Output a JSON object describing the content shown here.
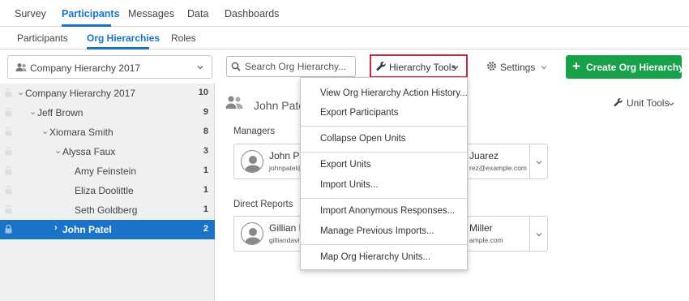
{
  "topnav": {
    "items": [
      "Survey",
      "Participants",
      "Messages",
      "Data",
      "Dashboards"
    ],
    "active": "Participants"
  },
  "subnav": {
    "items": [
      "Participants",
      "Org Hierarchies",
      "Roles"
    ],
    "active": "Org Hierarchies"
  },
  "toolbar": {
    "hierarchy_select": "Company Hierarchy 2017",
    "search_placeholder": "Search Org Hierarchy...",
    "hierarchy_tools": "Hierarchy Tools",
    "settings": "Settings",
    "create": "Create Org Hierarchy..."
  },
  "tree": [
    {
      "name": "Company Hierarchy 2017",
      "count": "10",
      "arrow": "⌄",
      "selected": false
    },
    {
      "name": "Jeff Brown",
      "count": "9",
      "arrow": "⌄",
      "selected": false
    },
    {
      "name": "Xiomara Smith",
      "count": "8",
      "arrow": "⌄",
      "selected": false
    },
    {
      "name": "Alyssa Faux",
      "count": "3",
      "arrow": "⌄",
      "selected": false
    },
    {
      "name": "Amy Feinstein",
      "count": "1",
      "arrow": "",
      "selected": false
    },
    {
      "name": "Eliza Doolittle",
      "count": "1",
      "arrow": "",
      "selected": false
    },
    {
      "name": "Seth Goldberg",
      "count": "1",
      "arrow": "",
      "selected": false
    },
    {
      "name": "John Patel",
      "count": "2",
      "arrow": "›",
      "selected": true
    }
  ],
  "main": {
    "title": "John Patel",
    "unit_tools": "Unit Tools",
    "managers_label": "Managers",
    "direct_reports_label": "Direct Reports",
    "managers_card": {
      "p1_name": "John Pa",
      "p1_email": "johnpatel@",
      "p2_name": "Juarez",
      "p2_email": "rez@example.com"
    },
    "reports_card": {
      "p1_name": "Gillian D",
      "p1_email": "gilliandavi",
      "p2_name": "Miller",
      "p2_email": "ample.com"
    }
  },
  "menu": {
    "items": [
      "View Org Hierarchy Action History...",
      "Export Participants",
      "Collapse Open Units",
      "Export Units",
      "Import Units...",
      "Import Anonymous Responses...",
      "Manage Previous Imports...",
      "Map Org Hierarchy Units..."
    ]
  },
  "colors": {
    "accent": "#1a73c7",
    "create_button": "#18a04a",
    "highlight_border": "#c8283d"
  }
}
